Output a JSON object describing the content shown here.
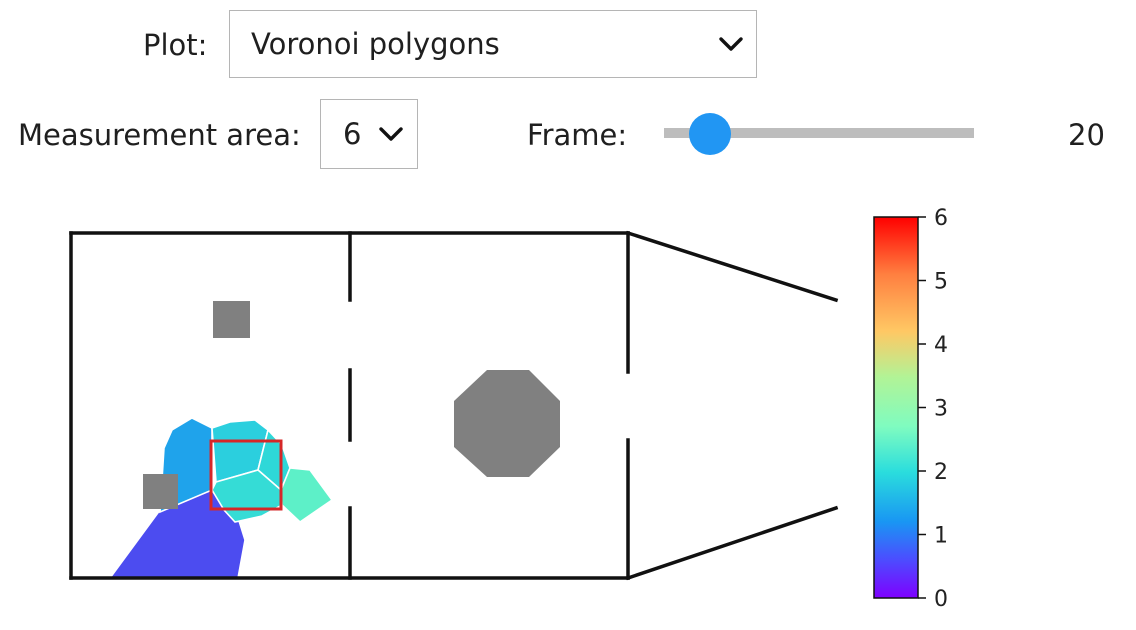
{
  "controls": {
    "plot_label": "Plot:",
    "plot_value": "Voronoi polygons",
    "area_label": "Measurement area:",
    "area_value": "6",
    "frame_label": "Frame:",
    "frame_value": "20"
  },
  "colorbar": {
    "ticks": [
      "6",
      "5",
      "4",
      "3",
      "2",
      "1",
      "0"
    ],
    "colormap": "rainbow"
  },
  "colors": {
    "slider_accent": "#2196f3",
    "obstacle": "#808080",
    "measurement_area": "#d62728"
  }
}
